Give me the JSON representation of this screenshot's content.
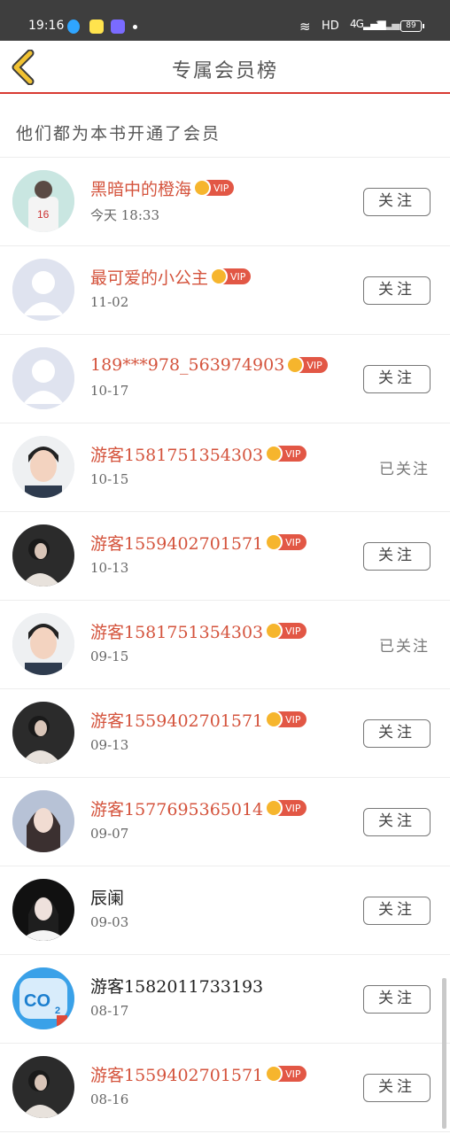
{
  "status_bar": {
    "time": "19:16",
    "network": "HD",
    "signal": "4G",
    "battery": "89"
  },
  "nav": {
    "title": "专属会员榜"
  },
  "subheader": {
    "text": "他们都为本书开通了会员"
  },
  "vip_label": "VIP",
  "members": [
    {
      "name": "黑暗中的橙海",
      "vip": true,
      "date": "今天 18:33",
      "action": "关注",
      "followed": false,
      "avatar": "photo-jersey"
    },
    {
      "name": "最可爱的小公主",
      "vip": true,
      "date": "11-02",
      "action": "关注",
      "followed": false,
      "avatar": "default-person"
    },
    {
      "name": "189***978_563974903",
      "vip": true,
      "date": "10-17",
      "action": "关注",
      "followed": false,
      "avatar": "default-person"
    },
    {
      "name": "游客1581751354303",
      "vip": true,
      "date": "10-15",
      "action": "已关注",
      "followed": true,
      "avatar": "photo-man"
    },
    {
      "name": "游客1559402701571",
      "vip": true,
      "date": "10-13",
      "action": "关注",
      "followed": false,
      "avatar": "photo-dark"
    },
    {
      "name": "游客1581751354303",
      "vip": true,
      "date": "09-15",
      "action": "已关注",
      "followed": true,
      "avatar": "photo-man"
    },
    {
      "name": "游客1559402701571",
      "vip": true,
      "date": "09-13",
      "action": "关注",
      "followed": false,
      "avatar": "photo-dark"
    },
    {
      "name": "游客1577695365014",
      "vip": true,
      "date": "09-07",
      "action": "关注",
      "followed": false,
      "avatar": "photo-girl"
    },
    {
      "name": "辰阑",
      "vip": false,
      "date": "09-03",
      "action": "关注",
      "followed": false,
      "avatar": "photo-costume"
    },
    {
      "name": "游客1582011733193",
      "vip": false,
      "date": "08-17",
      "action": "关注",
      "followed": false,
      "avatar": "co2-icon"
    },
    {
      "name": "游客1559402701571",
      "vip": true,
      "date": "08-16",
      "action": "关注",
      "followed": false,
      "avatar": "photo-dark"
    }
  ],
  "colors": {
    "accent_red": "#d83a32",
    "name_red": "#d4533c",
    "vip_badge": "#e25745",
    "crown_gold": "#f6b52d",
    "back_arrow": "#f1c232"
  }
}
